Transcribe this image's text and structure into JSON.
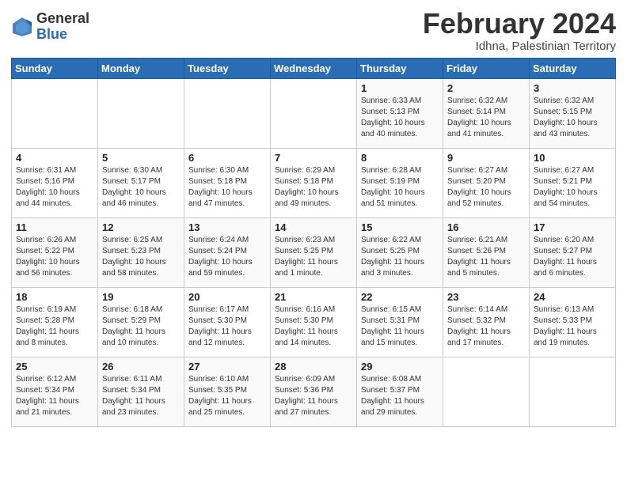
{
  "header": {
    "logo_general": "General",
    "logo_blue": "Blue",
    "month_title": "February 2024",
    "location": "Idhna, Palestinian Territory"
  },
  "days_of_week": [
    "Sunday",
    "Monday",
    "Tuesday",
    "Wednesday",
    "Thursday",
    "Friday",
    "Saturday"
  ],
  "weeks": [
    [
      {
        "day": "",
        "info": ""
      },
      {
        "day": "",
        "info": ""
      },
      {
        "day": "",
        "info": ""
      },
      {
        "day": "",
        "info": ""
      },
      {
        "day": "1",
        "info": "Sunrise: 6:33 AM\nSunset: 5:13 PM\nDaylight: 10 hours\nand 40 minutes."
      },
      {
        "day": "2",
        "info": "Sunrise: 6:32 AM\nSunset: 5:14 PM\nDaylight: 10 hours\nand 41 minutes."
      },
      {
        "day": "3",
        "info": "Sunrise: 6:32 AM\nSunset: 5:15 PM\nDaylight: 10 hours\nand 43 minutes."
      }
    ],
    [
      {
        "day": "4",
        "info": "Sunrise: 6:31 AM\nSunset: 5:16 PM\nDaylight: 10 hours\nand 44 minutes."
      },
      {
        "day": "5",
        "info": "Sunrise: 6:30 AM\nSunset: 5:17 PM\nDaylight: 10 hours\nand 46 minutes."
      },
      {
        "day": "6",
        "info": "Sunrise: 6:30 AM\nSunset: 5:18 PM\nDaylight: 10 hours\nand 47 minutes."
      },
      {
        "day": "7",
        "info": "Sunrise: 6:29 AM\nSunset: 5:18 PM\nDaylight: 10 hours\nand 49 minutes."
      },
      {
        "day": "8",
        "info": "Sunrise: 6:28 AM\nSunset: 5:19 PM\nDaylight: 10 hours\nand 51 minutes."
      },
      {
        "day": "9",
        "info": "Sunrise: 6:27 AM\nSunset: 5:20 PM\nDaylight: 10 hours\nand 52 minutes."
      },
      {
        "day": "10",
        "info": "Sunrise: 6:27 AM\nSunset: 5:21 PM\nDaylight: 10 hours\nand 54 minutes."
      }
    ],
    [
      {
        "day": "11",
        "info": "Sunrise: 6:26 AM\nSunset: 5:22 PM\nDaylight: 10 hours\nand 56 minutes."
      },
      {
        "day": "12",
        "info": "Sunrise: 6:25 AM\nSunset: 5:23 PM\nDaylight: 10 hours\nand 58 minutes."
      },
      {
        "day": "13",
        "info": "Sunrise: 6:24 AM\nSunset: 5:24 PM\nDaylight: 10 hours\nand 59 minutes."
      },
      {
        "day": "14",
        "info": "Sunrise: 6:23 AM\nSunset: 5:25 PM\nDaylight: 11 hours\nand 1 minute."
      },
      {
        "day": "15",
        "info": "Sunrise: 6:22 AM\nSunset: 5:25 PM\nDaylight: 11 hours\nand 3 minutes."
      },
      {
        "day": "16",
        "info": "Sunrise: 6:21 AM\nSunset: 5:26 PM\nDaylight: 11 hours\nand 5 minutes."
      },
      {
        "day": "17",
        "info": "Sunrise: 6:20 AM\nSunset: 5:27 PM\nDaylight: 11 hours\nand 6 minutes."
      }
    ],
    [
      {
        "day": "18",
        "info": "Sunrise: 6:19 AM\nSunset: 5:28 PM\nDaylight: 11 hours\nand 8 minutes."
      },
      {
        "day": "19",
        "info": "Sunrise: 6:18 AM\nSunset: 5:29 PM\nDaylight: 11 hours\nand 10 minutes."
      },
      {
        "day": "20",
        "info": "Sunrise: 6:17 AM\nSunset: 5:30 PM\nDaylight: 11 hours\nand 12 minutes."
      },
      {
        "day": "21",
        "info": "Sunrise: 6:16 AM\nSunset: 5:30 PM\nDaylight: 11 hours\nand 14 minutes."
      },
      {
        "day": "22",
        "info": "Sunrise: 6:15 AM\nSunset: 5:31 PM\nDaylight: 11 hours\nand 15 minutes."
      },
      {
        "day": "23",
        "info": "Sunrise: 6:14 AM\nSunset: 5:32 PM\nDaylight: 11 hours\nand 17 minutes."
      },
      {
        "day": "24",
        "info": "Sunrise: 6:13 AM\nSunset: 5:33 PM\nDaylight: 11 hours\nand 19 minutes."
      }
    ],
    [
      {
        "day": "25",
        "info": "Sunrise: 6:12 AM\nSunset: 5:34 PM\nDaylight: 11 hours\nand 21 minutes."
      },
      {
        "day": "26",
        "info": "Sunrise: 6:11 AM\nSunset: 5:34 PM\nDaylight: 11 hours\nand 23 minutes."
      },
      {
        "day": "27",
        "info": "Sunrise: 6:10 AM\nSunset: 5:35 PM\nDaylight: 11 hours\nand 25 minutes."
      },
      {
        "day": "28",
        "info": "Sunrise: 6:09 AM\nSunset: 5:36 PM\nDaylight: 11 hours\nand 27 minutes."
      },
      {
        "day": "29",
        "info": "Sunrise: 6:08 AM\nSunset: 5:37 PM\nDaylight: 11 hours\nand 29 minutes."
      },
      {
        "day": "",
        "info": ""
      },
      {
        "day": "",
        "info": ""
      }
    ]
  ]
}
